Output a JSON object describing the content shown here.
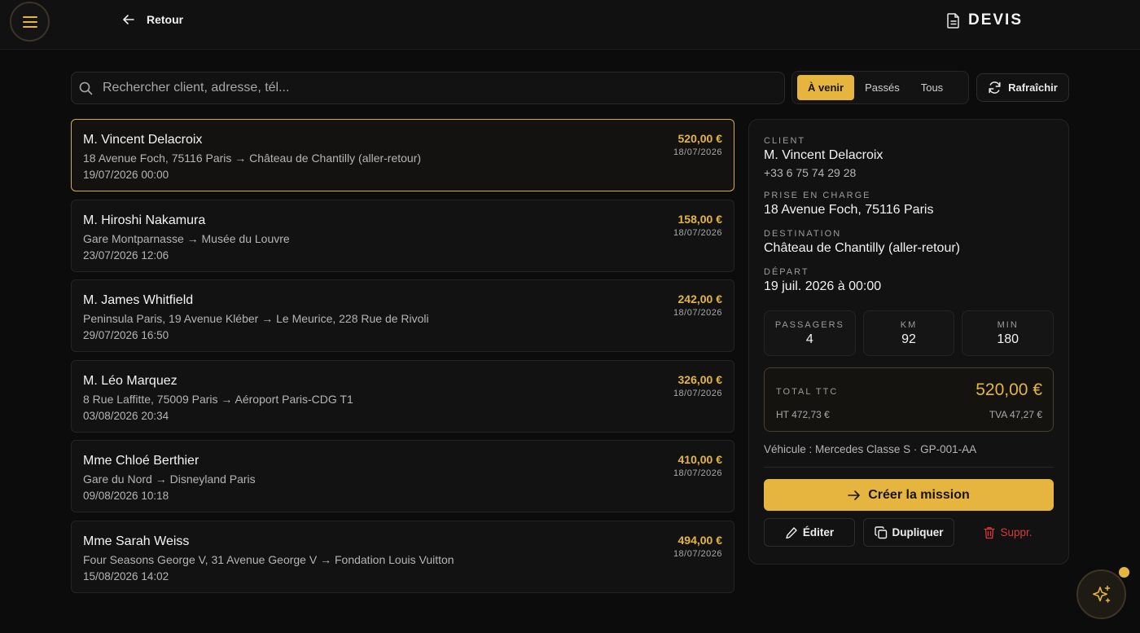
{
  "header": {
    "back_label": "Retour",
    "title": "DEVIS"
  },
  "search": {
    "placeholder": "Rechercher client, adresse, tél..."
  },
  "filters": {
    "upcoming": "À venir",
    "past": "Passés",
    "all": "Tous",
    "active": "upcoming"
  },
  "refresh_label": "Rafraîchir",
  "quotes": [
    {
      "name": "M. Vincent Delacroix",
      "route": "18 Avenue Foch, 75116 Paris → Château de Chantilly (aller-retour)",
      "date": "19/07/2026 00:00",
      "amount": "520,00 €",
      "created": "18/07/2026"
    },
    {
      "name": "M. Hiroshi Nakamura",
      "route": "Gare Montparnasse → Musée du Louvre",
      "date": "23/07/2026 12:06",
      "amount": "158,00 €",
      "created": "18/07/2026"
    },
    {
      "name": "M. James Whitfield",
      "route": "Peninsula Paris, 19 Avenue Kléber → Le Meurice, 228 Rue de Rivoli",
      "date": "29/07/2026 16:50",
      "amount": "242,00 €",
      "created": "18/07/2026"
    },
    {
      "name": "M. Léo Marquez",
      "route": "8 Rue Laffitte, 75009 Paris → Aéroport Paris-CDG T1",
      "date": "03/08/2026 20:34",
      "amount": "326,00 €",
      "created": "18/07/2026"
    },
    {
      "name": "Mme Chloé Berthier",
      "route": "Gare du Nord → Disneyland Paris",
      "date": "09/08/2026 10:18",
      "amount": "410,00 €",
      "created": "18/07/2026"
    },
    {
      "name": "Mme Sarah Weiss",
      "route": "Four Seasons George V, 31 Avenue George V → Fondation Louis Vuitton",
      "date": "15/08/2026 14:02",
      "amount": "494,00 €",
      "created": "18/07/2026"
    }
  ],
  "detail": {
    "client_label": "CLIENT",
    "client_name": "M. Vincent Delacroix",
    "client_phone": "+33 6 75 74 29 28",
    "pickup_label": "PRISE EN CHARGE",
    "pickup": "18 Avenue Foch, 75116 Paris",
    "destination_label": "DESTINATION",
    "destination": "Château de Chantilly (aller-retour)",
    "departure_label": "DÉPART",
    "departure": "19 juil. 2026 à 00:00",
    "stats": [
      {
        "label": "PASSAGERS",
        "value": "4"
      },
      {
        "label": "KM",
        "value": "92"
      },
      {
        "label": "MIN",
        "value": "180"
      }
    ],
    "total_label": "TOTAL TTC",
    "total": "520,00 €",
    "ht": "HT 472,73 €",
    "tva": "TVA 47,27 €",
    "vehicle": "Véhicule : Mercedes Classe S · GP-001-AA",
    "create_label": "Créer la mission",
    "edit_label": "Éditer",
    "duplicate_label": "Dupliquer",
    "delete_label": "Suppr."
  },
  "colors": {
    "accent": "#e5b540",
    "danger": "#d83a3a",
    "background": "#0c0c0c"
  },
  "icons": [
    "menu-icon",
    "arrow-left-icon",
    "document-icon",
    "search-icon",
    "refresh-icon",
    "arrow-right-icon",
    "pencil-icon",
    "copy-icon",
    "trash-icon",
    "sparkles-icon"
  ]
}
